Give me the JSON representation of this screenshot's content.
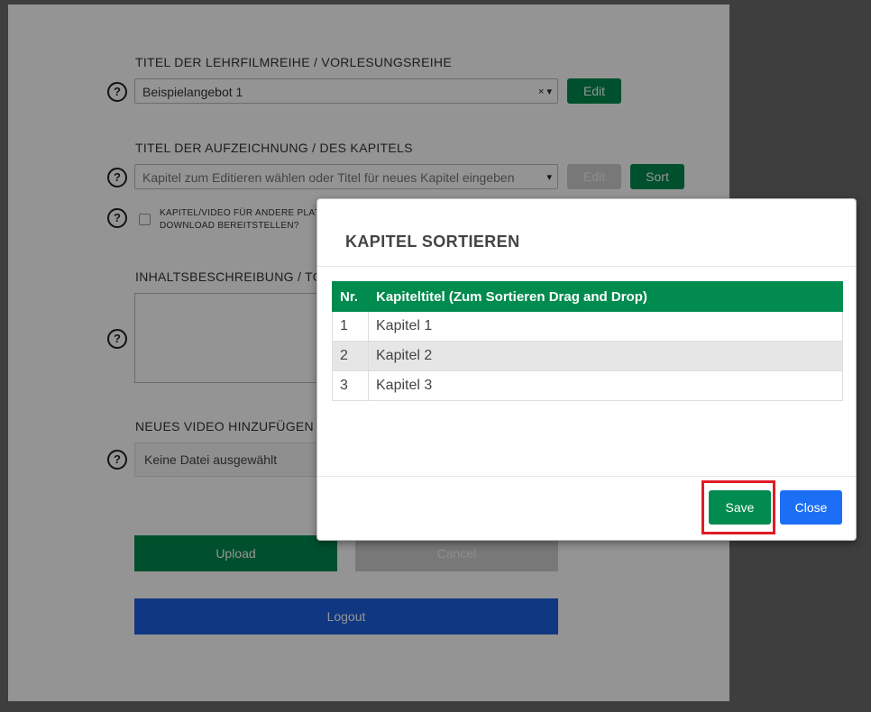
{
  "form": {
    "series_title_label": "TITEL DER LEHRFILMREIHE / VORLESUNGSREIHE",
    "series_select_value": "Beispielangebot 1",
    "series_select_clear": "× ▾",
    "edit_label": "Edit",
    "chapter_title_label": "TITEL DER AUFZEICHNUNG / DES KAPITELS",
    "chapter_select_placeholder": "Kapitel zum Editieren wählen oder Titel für neues Kapitel eingeben",
    "chapter_select_arrow": "▾",
    "chapter_edit_label": "Edit",
    "sort_label": "Sort",
    "download_checkbox_line1": "KAPITEL/VIDEO FÜR ANDERE PLAT",
    "download_checkbox_line2": "DOWNLOAD BEREITSTELLEN?",
    "description_label": "INHALTSBESCHREIBUNG / TOP",
    "new_video_label": "NEUES VIDEO HINZUFÜGEN",
    "file_input_value": "Keine Datei ausgewählt",
    "upload_label": "Upload",
    "cancel_label": "Cancel",
    "logout_label": "Logout",
    "help_glyph": "?"
  },
  "modal": {
    "title": "KAPITEL SORTIEREN",
    "columns": [
      "Nr.",
      "Kapiteltitel (Zum Sortieren Drag and Drop)"
    ],
    "rows": [
      {
        "nr": "1",
        "title": "Kapitel 1"
      },
      {
        "nr": "2",
        "title": "Kapitel 2"
      },
      {
        "nr": "3",
        "title": "Kapitel 3"
      }
    ],
    "save_label": "Save",
    "close_label": "Close"
  },
  "icons": {
    "help": "question-circle-icon",
    "clear": "clear-icon",
    "dropdown": "chevron-down-icon"
  },
  "colors": {
    "primary_green": "#028b4e",
    "close_blue": "#1c6ff5",
    "logout_blue": "#1a5fe0",
    "disabled_gray": "#cfcfcf",
    "highlight_red": "#e01b24"
  }
}
